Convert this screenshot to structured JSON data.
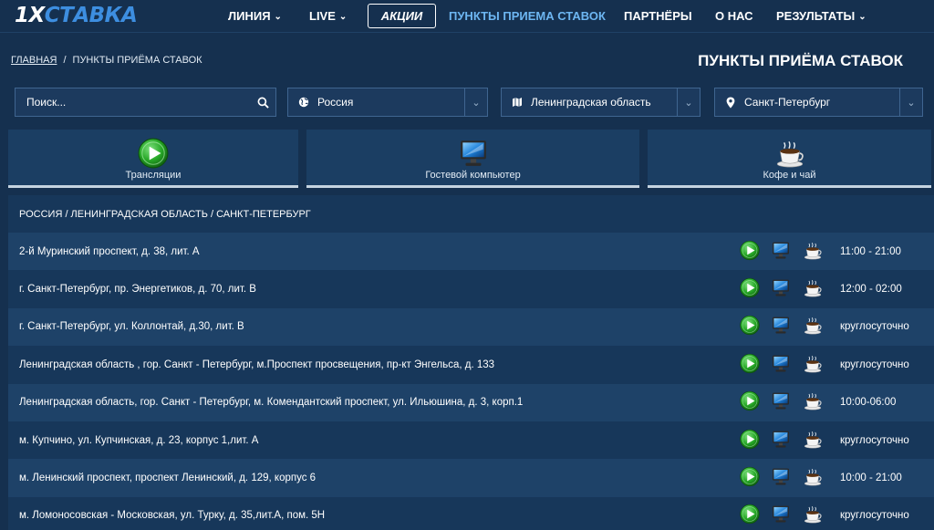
{
  "header": {
    "logo_main": "1X",
    "logo_accent": "СТАВКА",
    "nav": {
      "line": "ЛИНИЯ",
      "live": "LIVE",
      "promo": "АКЦИИ",
      "points": "ПУНКТЫ ПРИЕМА СТАВОК",
      "partners": "ПАРТНЁРЫ",
      "about": "О НАС",
      "results": "РЕЗУЛЬТАТЫ"
    },
    "active_color": "#6db6f2"
  },
  "breadcrumb": {
    "home": "ГЛАВНАЯ",
    "separator": "/",
    "current": "ПУНКТЫ ПРИЁМА СТАВОК"
  },
  "page_title": "ПУНКТЫ ПРИЁМА СТАВОК",
  "filters": {
    "search_placeholder": "Поиск...",
    "country": "Россия",
    "region": "Ленинградская область",
    "city": "Санкт-Петербург"
  },
  "features": [
    {
      "label": "Трансляции",
      "icon": "play-icon"
    },
    {
      "label": "Гостевой компьютер",
      "icon": "computer-icon"
    },
    {
      "label": "Кофе и чай",
      "icon": "coffee-cup-icon"
    }
  ],
  "table": {
    "heading": "РОССИЯ / ЛЕНИНГРАДСКАЯ ОБЛАСТЬ / САНКТ-ПЕТЕРБУРГ",
    "rows": [
      {
        "address": "2-й Муринский проспект, д. 38, лит. А",
        "hours": "11:00 - 21:00"
      },
      {
        "address": "г. Санкт-Петербург, пр. Энергетиков, д. 70, лит. В",
        "hours": "12:00 - 02:00"
      },
      {
        "address": "г. Санкт-Петербург, ул. Коллонтай, д.30, лит. В",
        "hours": "круглосуточно"
      },
      {
        "address": "Ленинградская область , гор. Санкт - Петербург, м.Проспект просвещения, пр-кт Энгельса, д. 133",
        "hours": "круглосуточно"
      },
      {
        "address": "Ленинградская область, гор. Санкт - Петербург, м. Комендантский проспект, ул. Ильюшина, д. 3, корп.1",
        "hours": "10:00-06:00"
      },
      {
        "address": "м. Купчино, ул. Купчинская, д. 23, корпус 1,лит. А",
        "hours": "круглосуточно"
      },
      {
        "address": "м. Ленинский проспект, проспект Ленинский, д. 129, корпус 6",
        "hours": "10:00 - 21:00"
      },
      {
        "address": "м. Ломоносовская - Московская, ул. Турку, д. 35,лит.А, пом. 5Н",
        "hours": "круглосуточно"
      }
    ]
  },
  "colors": {
    "background": "#15304f",
    "row_odd": "#1e4268",
    "row_even": "#17375a",
    "play_green": "#2fb52f"
  }
}
